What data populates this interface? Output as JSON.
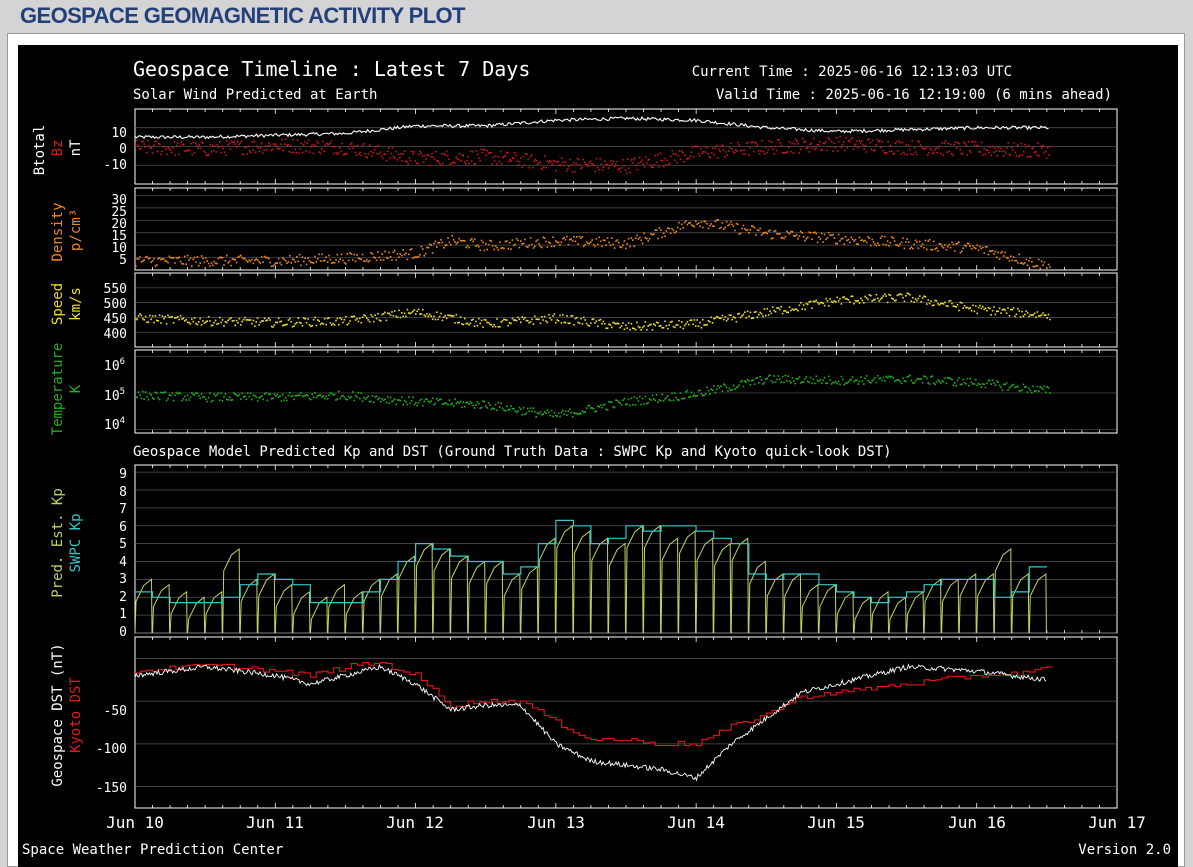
{
  "page_title": "GEOSPACE GEOMAGNETIC ACTIVITY PLOT",
  "header": {
    "title": "Geospace Timeline : Latest 7 Days",
    "subtitle": "Solar Wind Predicted at Earth",
    "current_time": "Current Time : 2025-06-16 12:13:03 UTC",
    "valid_time": "Valid Time : 2025-06-16 12:19:00 (6 mins ahead)",
    "kp_dst_title": "Geospace Model Predicted Kp and DST (Ground Truth Data : SWPC Kp and Kyoto quick-look DST)"
  },
  "footer": {
    "left": "Space Weather Prediction Center",
    "right": "Version 2.0"
  },
  "colors": {
    "background": "#000000",
    "btotal": "#ffffff",
    "bz": "#e01818",
    "density": "#f08a1e",
    "speed": "#f0e020",
    "temperature": "#20b020",
    "pred_kp": "#b8d860",
    "swpc_kp": "#30c8c8",
    "geospace_dst": "#ffffff",
    "kyoto_dst": "#e01818",
    "title_blue": "#24407a"
  },
  "chart_data": [
    {
      "type": "line",
      "panel": "magnetic-field",
      "ylabels": [
        "Btotal",
        "Bz",
        "nT"
      ],
      "ylim": [
        -20,
        20
      ],
      "yticks": [
        "10",
        "0",
        "-10"
      ],
      "x": [
        "Jun 10 00:00",
        "Jun 10 12:00",
        "Jun 11 00:00",
        "Jun 11 12:00",
        "Jun 12 00:00",
        "Jun 12 12:00",
        "Jun 13 00:00",
        "Jun 13 12:00",
        "Jun 14 00:00",
        "Jun 14 12:00",
        "Jun 15 00:00",
        "Jun 15 12:00",
        "Jun 16 00:00",
        "Jun 16 12:00"
      ],
      "series": [
        {
          "name": "Btotal",
          "values": [
            5,
            5,
            6,
            7,
            11,
            11,
            14,
            15,
            14,
            10,
            8,
            9,
            10,
            10
          ]
        },
        {
          "name": "Bz",
          "values": [
            0,
            -1,
            1,
            0,
            -6,
            -5,
            -9,
            -10,
            -3,
            0,
            2,
            0,
            -1,
            -2
          ]
        }
      ]
    },
    {
      "type": "scatter",
      "panel": "density",
      "ylabels": [
        "Density",
        "p/cm³"
      ],
      "ylim": [
        0,
        33
      ],
      "yticks": [
        "30",
        "25",
        "20",
        "15",
        "10",
        "5"
      ],
      "x": [
        "Jun 10 00:00",
        "Jun 10 12:00",
        "Jun 11 00:00",
        "Jun 11 12:00",
        "Jun 12 00:00",
        "Jun 12 06:00",
        "Jun 12 12:00",
        "Jun 13 00:00",
        "Jun 13 12:00",
        "Jun 14 00:00",
        "Jun 14 12:00",
        "Jun 15 00:00",
        "Jun 15 12:00",
        "Jun 16 00:00",
        "Jun 16 12:00"
      ],
      "values": [
        4,
        4,
        4,
        5,
        7,
        12,
        10,
        12,
        11,
        20,
        15,
        13,
        11,
        9,
        2
      ]
    },
    {
      "type": "scatter",
      "panel": "speed",
      "ylabels": [
        "Speed",
        "km/s"
      ],
      "ylim": [
        350,
        600
      ],
      "yticks": [
        "550",
        "500",
        "450",
        "400"
      ],
      "x": [
        "Jun 10 00:00",
        "Jun 10 12:00",
        "Jun 11 00:00",
        "Jun 11 12:00",
        "Jun 12 00:00",
        "Jun 12 12:00",
        "Jun 13 00:00",
        "Jun 13 12:00",
        "Jun 14 00:00",
        "Jun 14 12:00",
        "Jun 15 00:00",
        "Jun 15 12:00",
        "Jun 16 00:00",
        "Jun 16 12:00"
      ],
      "values": [
        450,
        440,
        435,
        440,
        470,
        430,
        450,
        420,
        430,
        470,
        510,
        520,
        480,
        460
      ]
    },
    {
      "type": "scatter",
      "panel": "temperature",
      "ylabels": [
        "Temperature",
        "K"
      ],
      "scale": "log",
      "ylim": [
        8000,
        1500000
      ],
      "yticks": [
        "10^6",
        "10^5",
        "10^4"
      ],
      "x": [
        "Jun 10 00:00",
        "Jun 10 12:00",
        "Jun 11 00:00",
        "Jun 11 12:00",
        "Jun 12 00:00",
        "Jun 12 12:00",
        "Jun 13 00:00",
        "Jun 13 12:00",
        "Jun 14 00:00",
        "Jun 14 12:00",
        "Jun 15 00:00",
        "Jun 15 12:00",
        "Jun 16 00:00",
        "Jun 16 12:00"
      ],
      "values": [
        90000,
        80000,
        80000,
        90000,
        60000,
        50000,
        25000,
        60000,
        100000,
        250000,
        230000,
        250000,
        200000,
        120000
      ]
    },
    {
      "type": "line",
      "panel": "kp",
      "ylabels": [
        "Pred. Est. Kp",
        "SWPC Kp"
      ],
      "ylim": [
        0,
        9
      ],
      "yticks": [
        "9",
        "8",
        "7",
        "6",
        "5",
        "4",
        "3",
        "2",
        "1",
        "0"
      ],
      "x": [
        "Jun 10 00:00",
        "Jun 10 03:00",
        "Jun 10 06:00",
        "Jun 10 09:00",
        "Jun 10 12:00",
        "Jun 10 15:00",
        "Jun 10 18:00",
        "Jun 10 21:00",
        "Jun 11 00:00",
        "Jun 11 03:00",
        "Jun 11 06:00",
        "Jun 11 09:00",
        "Jun 11 12:00",
        "Jun 11 15:00",
        "Jun 11 18:00",
        "Jun 11 21:00",
        "Jun 12 00:00",
        "Jun 12 03:00",
        "Jun 12 06:00",
        "Jun 12 09:00",
        "Jun 12 12:00",
        "Jun 12 15:00",
        "Jun 12 18:00",
        "Jun 12 21:00",
        "Jun 13 00:00",
        "Jun 13 03:00",
        "Jun 13 06:00",
        "Jun 13 09:00",
        "Jun 13 12:00",
        "Jun 13 15:00",
        "Jun 13 18:00",
        "Jun 13 21:00",
        "Jun 14 00:00",
        "Jun 14 03:00",
        "Jun 14 06:00",
        "Jun 14 09:00",
        "Jun 14 12:00",
        "Jun 14 15:00",
        "Jun 14 18:00",
        "Jun 14 21:00",
        "Jun 15 00:00",
        "Jun 15 03:00",
        "Jun 15 06:00",
        "Jun 15 09:00",
        "Jun 15 12:00",
        "Jun 15 15:00",
        "Jun 15 18:00",
        "Jun 15 21:00",
        "Jun 16 00:00",
        "Jun 16 03:00",
        "Jun 16 06:00",
        "Jun 16 09:00"
      ],
      "series": [
        {
          "name": "SWPC Kp",
          "values": [
            2.3,
            2.0,
            1.7,
            1.7,
            1.7,
            2.0,
            2.7,
            3.3,
            3.0,
            2.7,
            1.7,
            1.7,
            1.7,
            2.3,
            3.0,
            4.0,
            5.0,
            4.7,
            4.3,
            4.0,
            4.0,
            3.3,
            3.7,
            5.0,
            6.3,
            6.0,
            5.0,
            5.3,
            6.0,
            5.7,
            6.0,
            6.0,
            5.7,
            5.3,
            5.0,
            3.3,
            3.0,
            3.3,
            3.3,
            2.7,
            2.3,
            2.0,
            1.7,
            2.0,
            2.3,
            2.7,
            3.0,
            3.0,
            3.0,
            2.0,
            2.3,
            3.7
          ]
        },
        {
          "name": "Pred. Est. Kp",
          "values": [
            3.0,
            2.7,
            2.3,
            2.0,
            2.3,
            4.7,
            3.0,
            3.3,
            2.7,
            2.3,
            2.0,
            2.7,
            2.3,
            3.0,
            3.3,
            4.3,
            5.0,
            4.7,
            4.3,
            4.0,
            4.0,
            3.3,
            3.7,
            5.3,
            6.0,
            5.7,
            5.3,
            5.0,
            6.0,
            6.0,
            5.3,
            5.7,
            5.3,
            5.0,
            5.3,
            4.0,
            3.3,
            3.3,
            2.7,
            2.7,
            2.3,
            2.0,
            2.3,
            2.0,
            2.3,
            3.0,
            3.0,
            3.3,
            3.3,
            4.7,
            3.3,
            3.3
          ]
        }
      ]
    },
    {
      "type": "line",
      "panel": "dst",
      "ylabels": [
        "Geospace DST (nT)",
        "Kyoto DST"
      ],
      "ylim": [
        -175,
        25
      ],
      "yticks": [
        "-50",
        "-100",
        "-150"
      ],
      "x": [
        "Jun 10 00:00",
        "Jun 10 06:00",
        "Jun 10 12:00",
        "Jun 10 18:00",
        "Jun 11 00:00",
        "Jun 11 06:00",
        "Jun 11 12:00",
        "Jun 11 18:00",
        "Jun 12 00:00",
        "Jun 12 06:00",
        "Jun 12 12:00",
        "Jun 12 18:00",
        "Jun 13 00:00",
        "Jun 13 06:00",
        "Jun 13 12:00",
        "Jun 13 18:00",
        "Jun 14 00:00",
        "Jun 14 06:00",
        "Jun 14 12:00",
        "Jun 14 18:00",
        "Jun 15 00:00",
        "Jun 15 06:00",
        "Jun 15 12:00",
        "Jun 15 18:00",
        "Jun 16 00:00",
        "Jun 16 06:00",
        "Jun 16 12:00"
      ],
      "series": [
        {
          "name": "Geospace DST",
          "values": [
            -20,
            -15,
            -10,
            -15,
            -20,
            -30,
            -20,
            -10,
            -30,
            -60,
            -55,
            -55,
            -100,
            -120,
            -125,
            -130,
            -140,
            -100,
            -70,
            -40,
            -30,
            -20,
            -10,
            -12,
            -15,
            -20,
            -25
          ]
        },
        {
          "name": "Kyoto DST",
          "values": [
            -15,
            -12,
            -8,
            -10,
            -15,
            -20,
            -10,
            -5,
            -20,
            -55,
            -50,
            -50,
            -75,
            -95,
            -95,
            -100,
            -100,
            -80,
            -65,
            -45,
            -40,
            -35,
            -30,
            -25,
            -20,
            -18,
            -12
          ]
        }
      ]
    }
  ],
  "x_axis_labels": [
    "Jun 10",
    "Jun 11",
    "Jun 12",
    "Jun 13",
    "Jun 14",
    "Jun 15",
    "Jun 16",
    "Jun 17"
  ]
}
